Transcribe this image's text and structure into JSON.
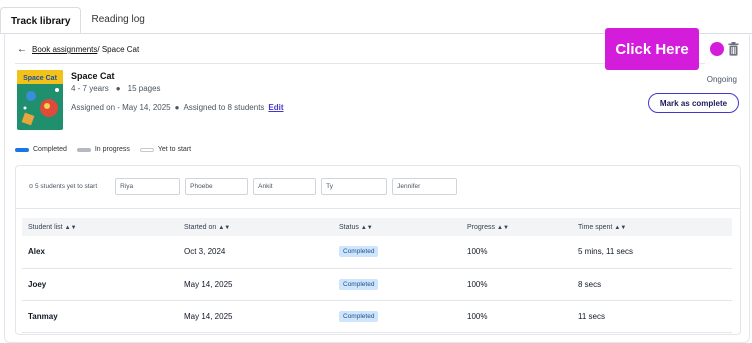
{
  "tabs": [
    {
      "label": "Track library",
      "active": true
    },
    {
      "label": "Reading log",
      "active": false
    }
  ],
  "breadcrumb": {
    "link": "Book assignments",
    "separator": "/",
    "current": " Space Cat"
  },
  "overlay": {
    "label": "Click Here",
    "color": "#d41cdb"
  },
  "book": {
    "title": "Space Cat",
    "age_range": "4 - 7 years",
    "pages": "15 pages",
    "assigned_on": "Assigned on - May 14, 2025",
    "assigned_to": "Assigned to 8 students",
    "edit_label": "Edit",
    "cover_title": "Space Cat",
    "state": "Ongoing",
    "mark_complete_label": "Mark as complete"
  },
  "legend": [
    {
      "label": "Completed",
      "color": "#1677e5"
    },
    {
      "label": "In progress",
      "color": "#b3b8c1"
    },
    {
      "label": "Yet to start",
      "color": "#ffffff"
    }
  ],
  "filter": {
    "yet_to_start": "5 students yet to start",
    "students": [
      "Riya",
      "Phoebe",
      "Ankit",
      "Ty",
      "Jennifer"
    ]
  },
  "table": {
    "headers": [
      "Student list",
      "Started on",
      "Status",
      "Progress",
      "Time spent"
    ],
    "rows": [
      {
        "name": "Alex",
        "started": "Oct 3, 2024",
        "status": "Completed",
        "progress": "100%",
        "time": "5 mins, 11 secs"
      },
      {
        "name": "Joey",
        "started": "May 14, 2025",
        "status": "Completed",
        "progress": "100%",
        "time": "8 secs"
      },
      {
        "name": "Tanmay",
        "started": "May 14, 2025",
        "status": "Completed",
        "progress": "100%",
        "time": "11 secs"
      }
    ]
  },
  "icons": {
    "back": "arrow-left-icon",
    "trash": "trash-icon",
    "sort": "sort-icon"
  }
}
